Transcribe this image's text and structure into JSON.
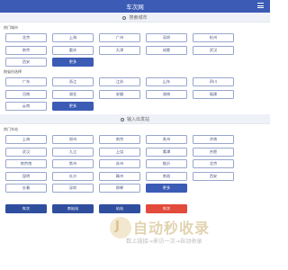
{
  "header": {
    "title": "车次网"
  },
  "search1": {
    "placeholder": "搜索城市"
  },
  "section1": {
    "label": "热门城市",
    "buttons": [
      "北京",
      "上海",
      "广州",
      "深圳",
      "杭州",
      "南京",
      "重庆",
      "天津",
      "成都",
      "武汉",
      "西安",
      "更多"
    ]
  },
  "section2": {
    "label": "按省份选择",
    "buttons": [
      "广东",
      "浙江",
      "江苏",
      "山东",
      "四川",
      "河南",
      "湖北",
      "安徽",
      "湖南",
      "福建",
      "云南",
      "更多"
    ]
  },
  "search2": {
    "placeholder": "输入出发站"
  },
  "section3": {
    "label": "热门车站",
    "buttons": [
      "上海",
      "郑州",
      "南京",
      "贵州",
      "济南",
      "武汉",
      "九江",
      "上饶",
      "鹰潭",
      "合肥",
      "南京南",
      "常州",
      "苏州",
      "临沂",
      "北京",
      "昆明",
      "长沙",
      "赣州",
      "南昌",
      "西安",
      "长春",
      "深圳",
      "邯郸",
      "更多"
    ]
  },
  "bottom_buttons": [
    {
      "label": "车次",
      "color": "#2f4f9e"
    },
    {
      "label": "南站站",
      "color": "#2f4f9e"
    },
    {
      "label": "站站",
      "color": "#2f4f9e"
    },
    {
      "label": "车次",
      "color": "#e24a3c"
    }
  ],
  "ad": {
    "big_text": "自动秒收录",
    "small_text": "数上链接→来访一次→自动收录"
  },
  "colors": {
    "primary": "#3b5bb5",
    "border": "#98a6cc",
    "accent": "#e24a3c"
  }
}
